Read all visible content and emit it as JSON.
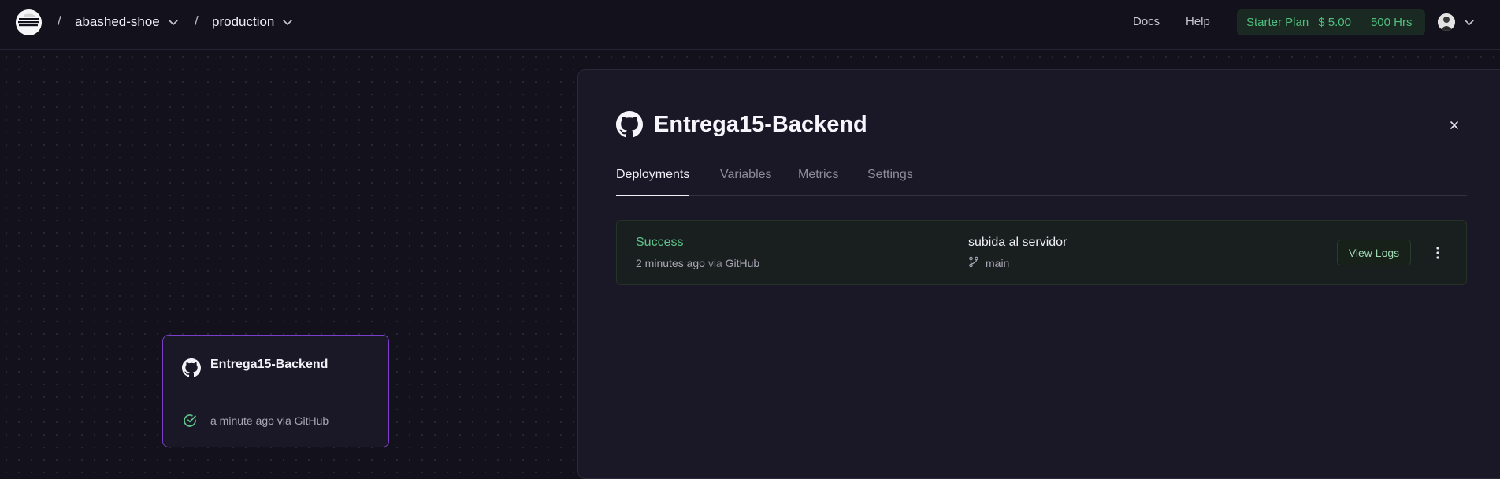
{
  "breadcrumb": {
    "project": "abashed-shoe",
    "environment": "production"
  },
  "nav": {
    "docs": "Docs",
    "help": "Help"
  },
  "plan": {
    "name": "Starter Plan",
    "credit": "$ 5.00",
    "hours": "500 Hrs"
  },
  "service_card": {
    "title": "Entrega15-Backend",
    "status": "a minute ago via GitHub"
  },
  "panel": {
    "title": "Entrega15-Backend",
    "tabs": [
      "Deployments",
      "Variables",
      "Metrics",
      "Settings"
    ],
    "active_tab": "Deployments",
    "deployment": {
      "status": "Success",
      "time": "2 minutes ago",
      "via_word": "via",
      "source": "GitHub",
      "commit_message": "subida al servidor",
      "branch": "main",
      "view_logs": "View Logs"
    }
  },
  "colors": {
    "background": "#13111c",
    "panel": "#1a1826",
    "accent_green": "#5ec48a",
    "card_border_purple": "#7b3fc9"
  },
  "icons": {
    "logo": "railway-logo-icon",
    "github": "github-icon",
    "chevron": "chevron-down-icon",
    "close": "close-icon",
    "check": "check-circle-icon",
    "branch": "git-branch-icon",
    "more": "more-vertical-icon"
  }
}
